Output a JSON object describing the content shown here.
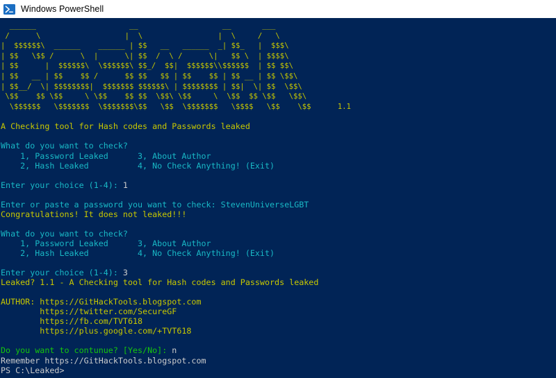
{
  "window": {
    "title": "Windows PowerShell",
    "icon": "powershell-icon",
    "background_color": "#012456",
    "titlebar_color": "#ffffff"
  },
  "colors": {
    "yellow": "#c8c800",
    "cyan": "#19b9c6",
    "green": "#16c60c",
    "white": "#cccccc",
    "background": "#012456"
  },
  "banner": {
    "art": "  ______                     __                   __       ___             \n /      \\                   |  \\                 |  \\     /   \\            \n|  $$$$$$\\  ______    ______ | $$   __   ______  _| $$_   |  $$$\\           \n| $$   \\$$ /      \\  |      \\| $$  /  \\ /      \\|   $$ \\  | $$$$\\          \n| $$      |  $$$$$$\\  \\$$$$$$\\ $$_/  $$|  $$$$$$\\\\$$$$$$  | $$ $$\\         \n| $$   __ | $$    $$ /      $$ $$   $$ | $$    $$ | $$ __ | $$ \\$$\\        \n| $$__/  \\| $$$$$$$$|  $$$$$$$ $$$$$$\\ | $$$$$$$$ | $$|  \\| $$  \\$$\\       \n \\$$    $$ \\$$     \\ \\$$    $$ $$  \\$$\\ \\$$     \\  \\$$  $$ \\$$   \\$$\\      \n  \\$$$$$$   \\$$$$$$$  \\$$$$$$$\\$$   \\$$  \\$$$$$$$   \\$$$$   \\$$    \\$$     ",
    "version": "1.1",
    "tagline": "A Checking tool for Hash codes and Passwords leaked"
  },
  "session": {
    "menu_prompt": "What do you want to check?",
    "menu_items": [
      {
        "key": "1,",
        "label": "Password Leaked"
      },
      {
        "key": "3,",
        "label": "About Author"
      },
      {
        "key": "2,",
        "label": "Hash Leaked"
      },
      {
        "key": "4,",
        "label": "No Check Anything! (Exit)"
      }
    ],
    "menu_line_1": "    1, Password Leaked      3, About Author",
    "menu_line_2": "    2, Hash Leaked          4, No Check Anything! (Exit)",
    "choice_prompt_1": "Enter your choice (1-4): ",
    "choice_value_1": "1",
    "password_prompt": "Enter or paste a password you want to check: ",
    "password_value": "StevenUniverseLGBT",
    "password_result": "Congratulations! It does not leaked!!!",
    "choice_prompt_2": "Enter your choice (1-4): ",
    "choice_value_2": "3",
    "about_line": "Leaked? 1.1 - A Checking tool for Hash codes and Passwords leaked",
    "author_label": "AUTHOR: ",
    "author_links": [
      "https://GitHackTools.blogspot.com",
      "https://twitter.com/SecureGF",
      "https://fb.com/TVT618",
      "https://plus.google.com/+TVT618"
    ],
    "author_indent": "        ",
    "continue_prompt": "Do you want to contunue? [Yes/No]: ",
    "continue_value": "n",
    "remember_line": "Remember https://GitHackTools.blogspot.com",
    "shell_prompt": "PS C:\\Leaked>"
  }
}
